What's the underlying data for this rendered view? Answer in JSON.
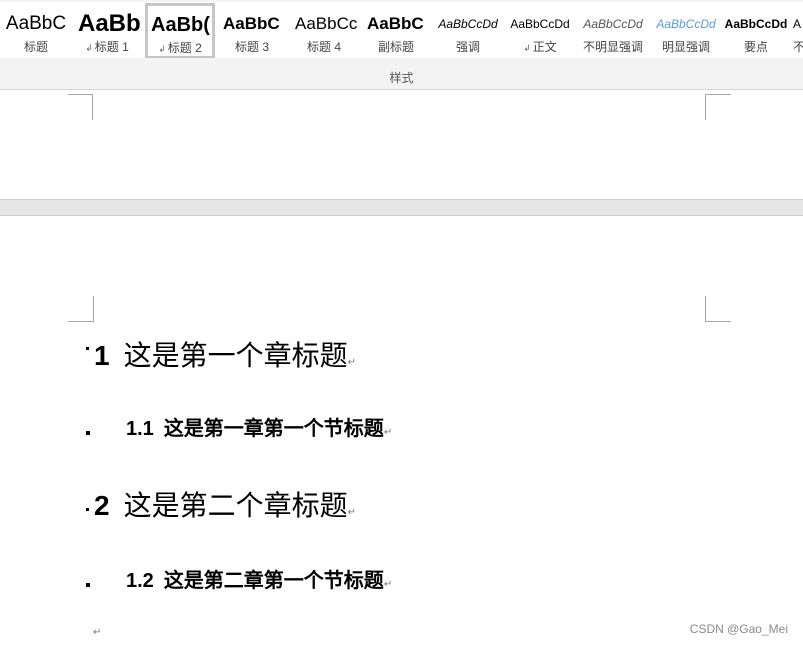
{
  "ribbon": {
    "group_label": "样式",
    "styles": [
      {
        "preview": "AaBbC",
        "label": "标题",
        "linked": false
      },
      {
        "preview": "AaBb",
        "label": "标题 1",
        "linked": true
      },
      {
        "preview": "AaBb(",
        "label": "标题 2",
        "linked": true,
        "selected": true
      },
      {
        "preview": "AaBbC",
        "label": "标题 3",
        "linked": false
      },
      {
        "preview": "AaBbCc",
        "label": "标题 4",
        "linked": false
      },
      {
        "preview": "AaBbC",
        "label": "副标题",
        "linked": false
      },
      {
        "preview": "AaBbCcDd",
        "label": "强调",
        "linked": false
      },
      {
        "preview": "AaBbCcDd",
        "label": "正文",
        "linked": true
      },
      {
        "preview": "AaBbCcDd",
        "label": "不明显强调",
        "linked": false
      },
      {
        "preview": "AaBbCcDd",
        "label": "明显强调",
        "linked": false
      },
      {
        "preview": "AaBbCcDd",
        "label": "要点",
        "linked": false
      },
      {
        "preview": "A",
        "label": "不",
        "linked": false
      }
    ]
  },
  "document": {
    "headings": [
      {
        "level": 1,
        "number": "1",
        "text": "这是第一个章标题"
      },
      {
        "level": 2,
        "number": "1.1",
        "text": "这是第一章第一个节标题"
      },
      {
        "level": 1,
        "number": "2",
        "text": "这是第二个章标题"
      },
      {
        "level": 2,
        "number": "1.2",
        "text": "这是第二章第一个节标题"
      }
    ],
    "paragraph_mark": "↵"
  },
  "watermark": "CSDN @Gao_Mei",
  "colors": {
    "ribbon_bg": "#f3f3f3",
    "selected_border": "#c6c6c6",
    "intense_emphasis": "#5b9bd5",
    "page_gap": "#e6e6e6"
  }
}
